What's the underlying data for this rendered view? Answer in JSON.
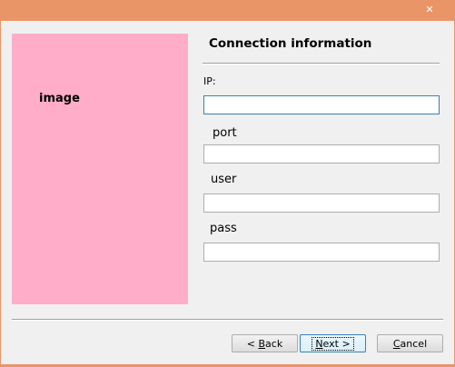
{
  "window": {
    "close_glyph": "✕"
  },
  "image_panel": {
    "label": "image"
  },
  "section": {
    "title": "Connection information"
  },
  "fields": {
    "ip": {
      "label": "IP:",
      "value": ""
    },
    "port": {
      "label": "port",
      "value": ""
    },
    "user": {
      "label": "user",
      "value": ""
    },
    "pass": {
      "label": "pass",
      "value": ""
    }
  },
  "buttons": {
    "back": {
      "prefix": "< ",
      "accel": "B",
      "rest": "ack"
    },
    "next": {
      "accel": "N",
      "rest": "ext >"
    },
    "cancel": {
      "accel": "C",
      "rest": "ancel"
    }
  },
  "colors": {
    "frame": "#ea9567",
    "image_panel": "#ffadc9",
    "client_bg": "#f0f0f0",
    "focus_border": "#3c7fb1"
  },
  "icons": {
    "close": "close-icon"
  }
}
